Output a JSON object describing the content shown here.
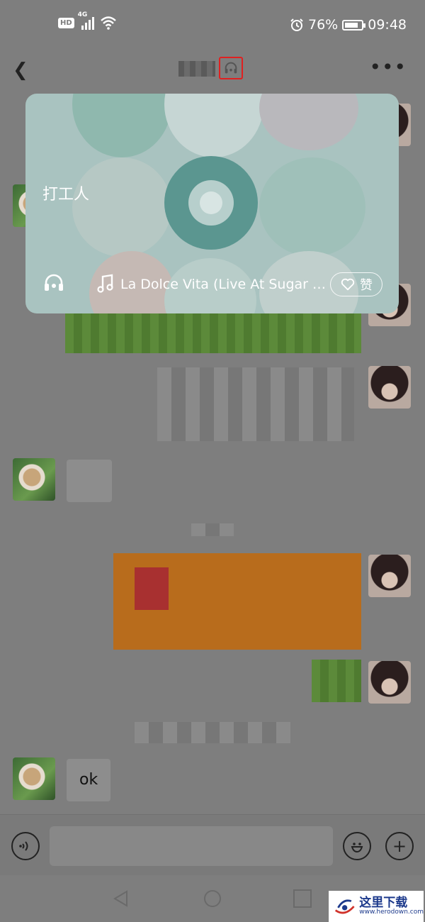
{
  "status_bar": {
    "hd": "HD",
    "network": "4G",
    "battery": "76%",
    "time": "09:48"
  },
  "music_card": {
    "name": "打工人",
    "song": "La Dolce Vita (Live At Sugar M...",
    "like_label": "赞"
  },
  "messages": {
    "ok_text": "ok"
  },
  "watermark": {
    "name": "这里下载",
    "url": "www.herodown.com"
  },
  "colors": {
    "highlight_box": "#e02020",
    "card_accent": "#5b9690"
  }
}
